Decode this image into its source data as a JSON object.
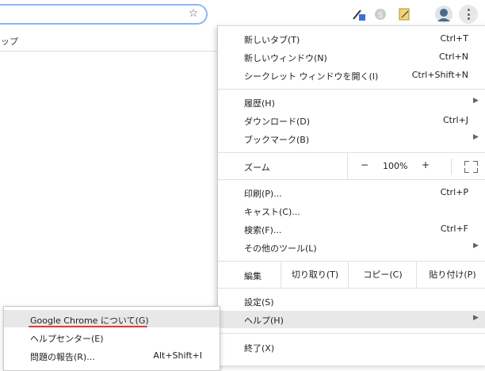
{
  "bookmarks_bar": {
    "partial_label": "ップ"
  },
  "toolbar": {
    "icons": [
      "star-icon",
      "eyedropper-extension-icon",
      "skype-extension-icon",
      "notes-extension-icon",
      "profile-avatar-icon",
      "menu-kebab-icon"
    ],
    "accent": "#8ab4f8"
  },
  "menu": {
    "items": {
      "new_tab": {
        "label": "新しいタブ(T)",
        "shortcut": "Ctrl+T"
      },
      "new_window": {
        "label": "新しいウィンドウ(N)",
        "shortcut": "Ctrl+N"
      },
      "incognito": {
        "label": "シークレット ウィンドウを開く(I)",
        "shortcut": "Ctrl+Shift+N"
      },
      "history": {
        "label": "履歴(H)"
      },
      "downloads": {
        "label": "ダウンロード(D)",
        "shortcut": "Ctrl+J"
      },
      "bookmarks": {
        "label": "ブックマーク(B)"
      },
      "print": {
        "label": "印刷(P)...",
        "shortcut": "Ctrl+P"
      },
      "cast": {
        "label": "キャスト(C)..."
      },
      "find": {
        "label": "検索(F)...",
        "shortcut": "Ctrl+F"
      },
      "more_tools": {
        "label": "その他のツール(L)"
      },
      "settings": {
        "label": "設定(S)"
      },
      "help": {
        "label": "ヘルプ(H)"
      },
      "exit": {
        "label": "終了(X)"
      }
    },
    "zoom": {
      "label": "ズーム",
      "minus": "−",
      "value": "100%",
      "plus": "+"
    },
    "edit": {
      "label": "編集",
      "cut": "切り取り(T)",
      "copy": "コピー(C)",
      "paste": "貼り付け(P)"
    },
    "highlight_color": "#e8e8e8"
  },
  "help_submenu": {
    "about": {
      "label": "Google Chrome について(G)"
    },
    "help_center": {
      "label": "ヘルプセンター(E)"
    },
    "report": {
      "label": "問題の報告(R)...",
      "shortcut": "Alt+Shift+I"
    },
    "underline_color": "#e53935"
  }
}
